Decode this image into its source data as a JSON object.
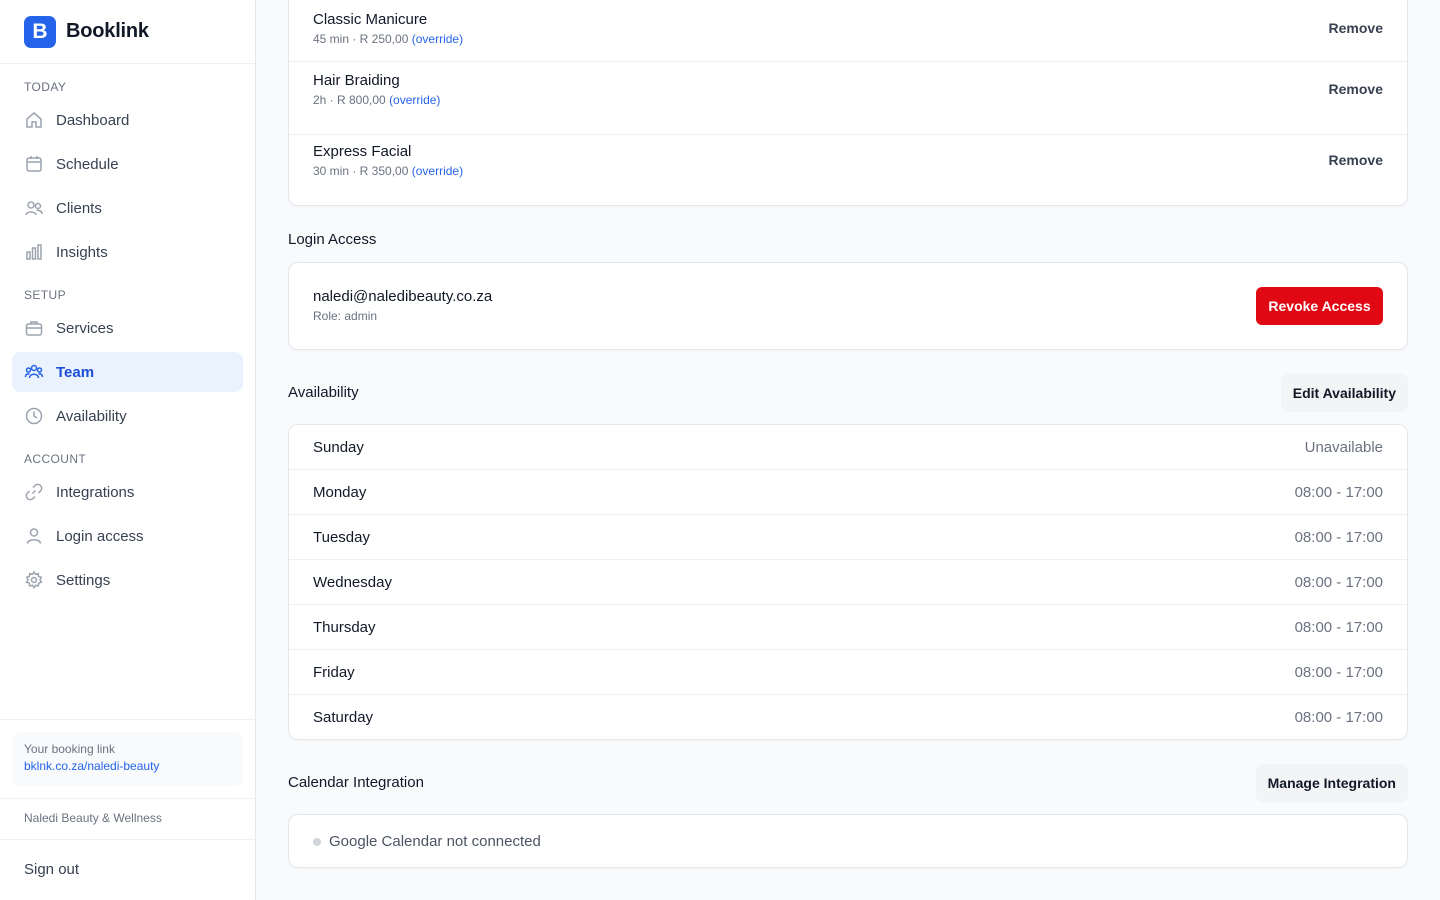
{
  "sidebar": {
    "brand": {
      "logo_letter": "B",
      "name": "Booklink"
    },
    "sections": {
      "today": "TODAY",
      "setup": "SETUP",
      "account": "ACCOUNT"
    },
    "items": [
      {
        "label": "Dashboard",
        "icon": "home-icon"
      },
      {
        "label": "Schedule",
        "icon": "calendar-icon"
      },
      {
        "label": "Clients",
        "icon": "users-icon"
      },
      {
        "label": "Insights",
        "icon": "bar-chart-icon"
      },
      {
        "label": "Services",
        "icon": "briefcase-icon"
      },
      {
        "label": "Team",
        "icon": "team-icon",
        "active": true
      },
      {
        "label": "Availability",
        "icon": "clock-icon"
      },
      {
        "label": "Integrations",
        "icon": "link-icon"
      },
      {
        "label": "Login access",
        "icon": "user-icon"
      },
      {
        "label": "Settings",
        "icon": "gear-icon"
      }
    ],
    "booking": {
      "label": "Your booking link",
      "link": "bklnk.co.za/naledi-beauty"
    },
    "business_name": "Naledi Beauty & Wellness",
    "sign_out": "Sign out"
  },
  "services": [
    {
      "name": "Classic Manicure",
      "meta": "45 min · R 250,00",
      "override": "(override)",
      "action": "Remove"
    },
    {
      "name": "Hair Braiding",
      "meta": "2h · R 800,00",
      "override": "(override)",
      "action": "Remove"
    },
    {
      "name": "Express Facial",
      "meta": "30 min · R 350,00",
      "override": "(override)",
      "action": "Remove"
    }
  ],
  "login_access": {
    "title": "Login Access",
    "email": "naledi@naledibeauty.co.za",
    "role": "Role: admin",
    "revoke_label": "Revoke Access"
  },
  "availability": {
    "title": "Availability",
    "edit_label": "Edit Availability",
    "days": [
      {
        "day": "Sunday",
        "hours": "Unavailable"
      },
      {
        "day": "Monday",
        "hours": "08:00 - 17:00"
      },
      {
        "day": "Tuesday",
        "hours": "08:00 - 17:00"
      },
      {
        "day": "Wednesday",
        "hours": "08:00 - 17:00"
      },
      {
        "day": "Thursday",
        "hours": "08:00 - 17:00"
      },
      {
        "day": "Friday",
        "hours": "08:00 - 17:00"
      },
      {
        "day": "Saturday",
        "hours": "08:00 - 17:00"
      }
    ]
  },
  "calendar": {
    "title": "Calendar Integration",
    "manage_label": "Manage Integration",
    "status": "Google Calendar not connected"
  },
  "colors": {
    "accent": "#2563eb",
    "danger": "#e00812",
    "active_bg": "#eaf2fd"
  }
}
